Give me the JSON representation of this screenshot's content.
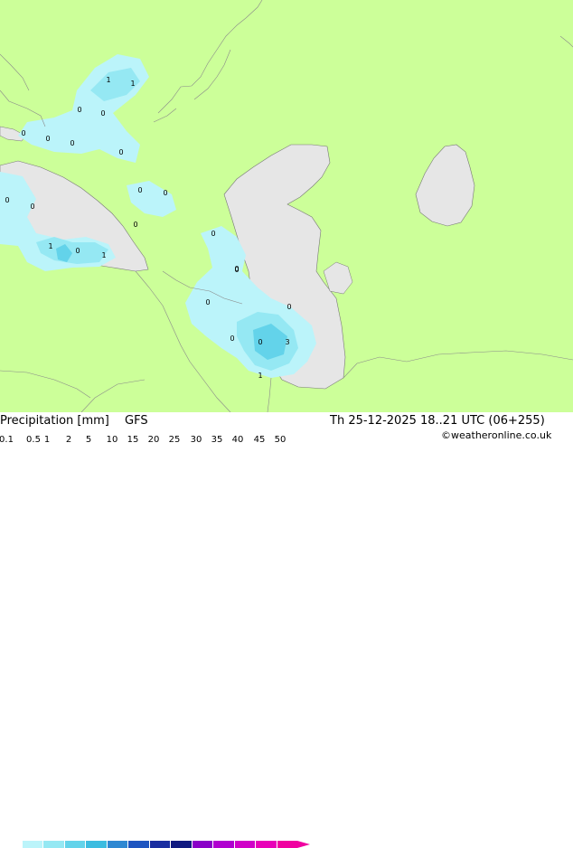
{
  "map": {
    "land_color": "#ccff99",
    "sea_color": "#e6e6e6",
    "precip_colors": [
      "#bbf4fa",
      "#95e8f3",
      "#63d3ea",
      "#3cbce0"
    ],
    "value_labels": [
      "1",
      "1",
      "0",
      "0",
      "0",
      "0",
      "0",
      "0",
      "0",
      "0",
      "0",
      "0",
      "0",
      "0",
      "1",
      "0",
      "1",
      "0",
      "0",
      "0",
      "0",
      "0",
      "3",
      "1",
      "0"
    ]
  },
  "footer": {
    "title": "Precipitation [mm]",
    "model": "GFS",
    "valid_time": "Th 25-12-2025 18..21 UTC (06+255)",
    "credit": "©weatheronline.co.uk"
  },
  "legend": {
    "ticks": [
      "0.1",
      "0.5",
      "1",
      "2",
      "5",
      "10",
      "15",
      "20",
      "25",
      "30",
      "35",
      "40",
      "45",
      "50"
    ],
    "colors": [
      "#ffffff",
      "#bbf4fa",
      "#95e8f3",
      "#63d3ea",
      "#3cbce0",
      "#2f88d2",
      "#1f55c0",
      "#1a2ea0",
      "#101a80",
      "#8a00c8",
      "#b000d0",
      "#d000c8",
      "#e800b8",
      "#f000a0"
    ]
  }
}
